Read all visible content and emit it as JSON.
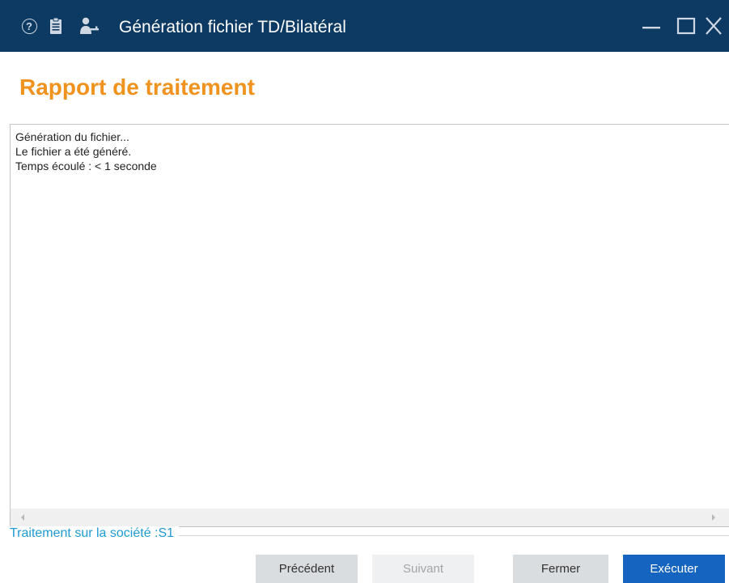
{
  "window": {
    "title": "Génération fichier TD/Bilatéral",
    "help_glyph": "?",
    "icons": [
      "help-icon",
      "clipboard-icon",
      "user-settings-icon",
      "minimize-icon",
      "maximize-icon",
      "close-icon"
    ]
  },
  "section": {
    "heading": "Rapport de traitement"
  },
  "report": {
    "lines": [
      "Génération du fichier...",
      "Le fichier a été généré.",
      "Temps écoulé : < 1 seconde"
    ]
  },
  "footer": {
    "company_label": "Traitement sur la société :S1"
  },
  "buttons": {
    "previous": "Précédent",
    "next": "Suivant",
    "close": "Fermer",
    "execute": "Exécuter"
  },
  "colors": {
    "titlebar": "#0d3a62",
    "heading": "#f0921e",
    "footer_label": "#1e9bd1",
    "primary_button": "#1565c0"
  }
}
